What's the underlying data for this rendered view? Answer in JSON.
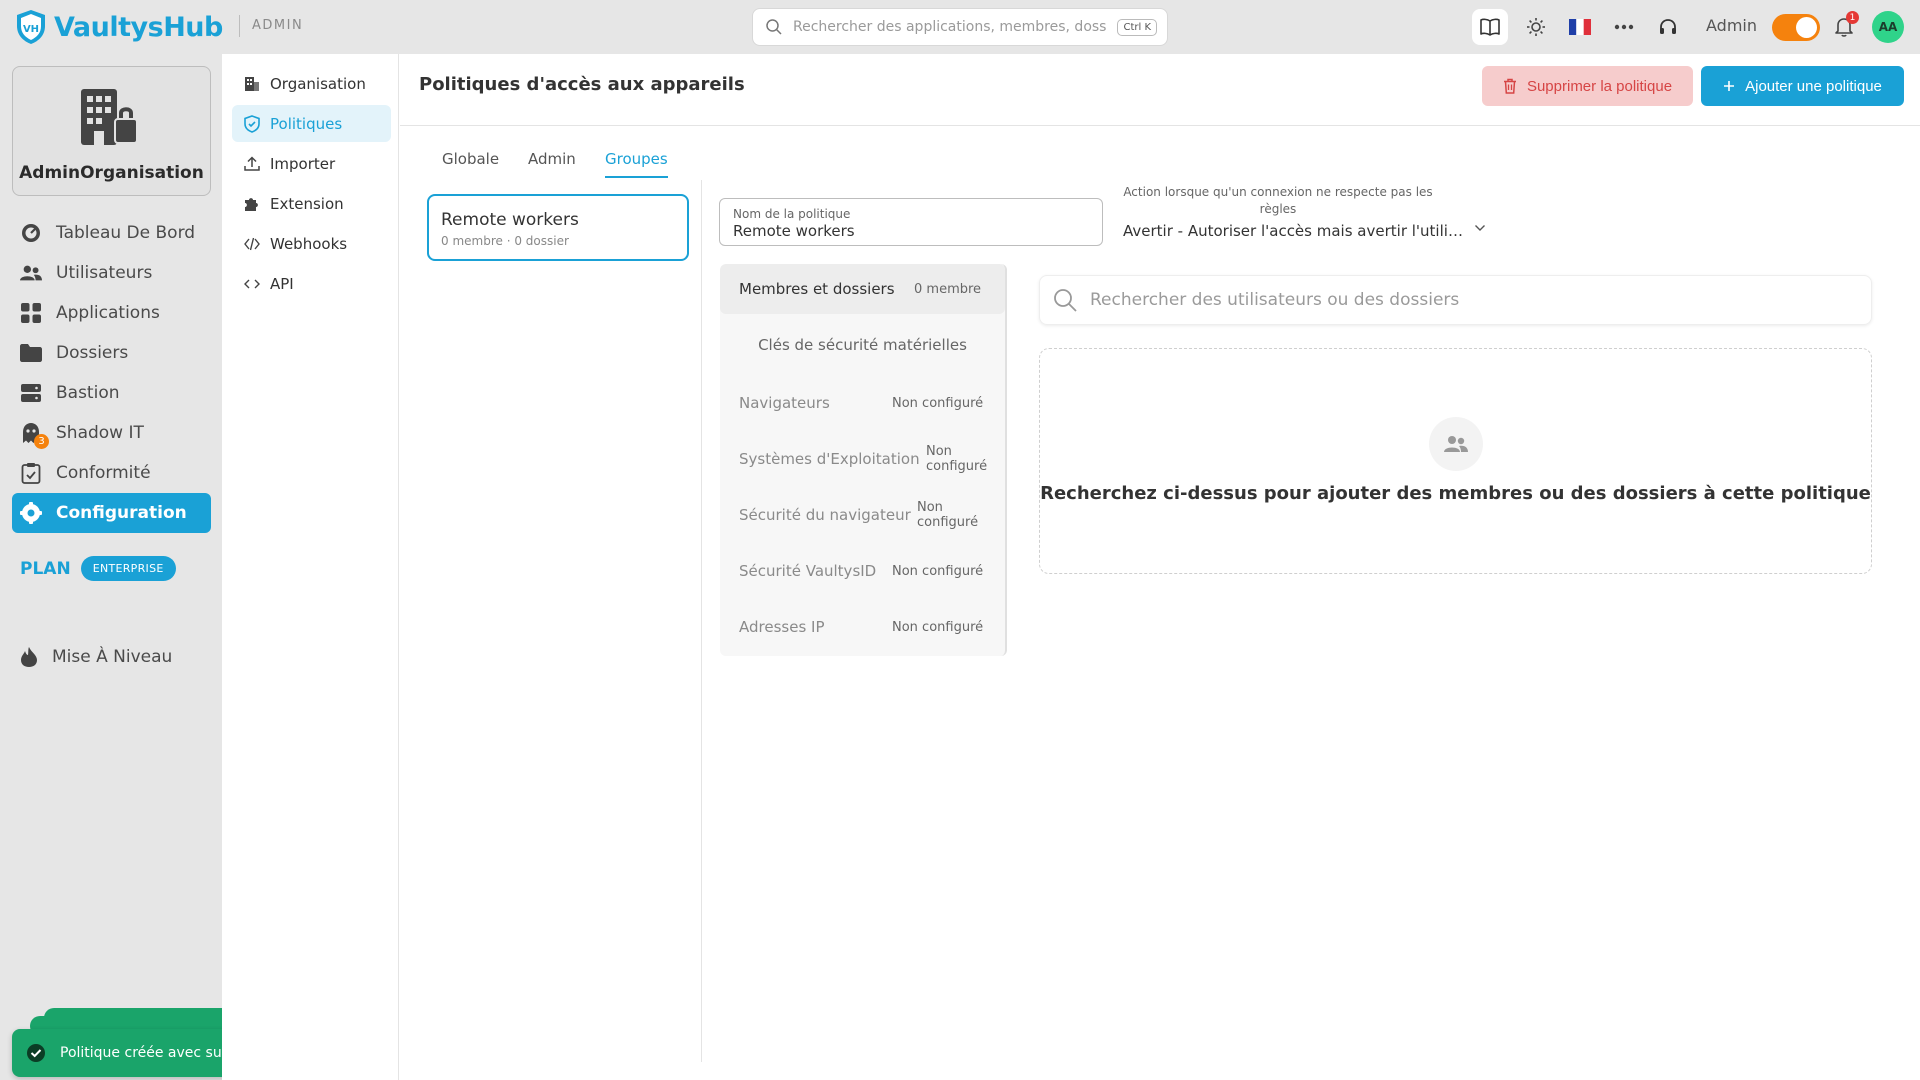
{
  "header": {
    "brand": "VaultysHub",
    "section": "ADMIN",
    "search_placeholder": "Rechercher des applications, membres, dossiers",
    "search_shortcut": "Ctrl K",
    "user_mode": "Admin",
    "notifications": "1",
    "avatar_initials": "AA"
  },
  "sidebar": {
    "org_name": "AdminOrganisation",
    "items": [
      {
        "label": "Tableau De Bord",
        "icon": "gauge-icon"
      },
      {
        "label": "Utilisateurs",
        "icon": "users-icon"
      },
      {
        "label": "Applications",
        "icon": "grid-icon"
      },
      {
        "label": "Dossiers",
        "icon": "folder-icon"
      },
      {
        "label": "Bastion",
        "icon": "server-icon"
      },
      {
        "label": "Shadow IT",
        "icon": "ghost-icon",
        "badge": "3"
      },
      {
        "label": "Conformité",
        "icon": "clipboard-check-icon"
      },
      {
        "label": "Configuration",
        "icon": "gear-icon",
        "active": true
      }
    ],
    "plan_label": "PLAN",
    "plan_badge": "ENTERPRISE",
    "upgrade": "Mise À Niveau"
  },
  "subnav": {
    "items": [
      {
        "label": "Organisation",
        "icon": "building-icon"
      },
      {
        "label": "Politiques",
        "icon": "shield-icon",
        "active": true
      },
      {
        "label": "Importer",
        "icon": "upload-icon"
      },
      {
        "label": "Extension",
        "icon": "puzzle-icon"
      },
      {
        "label": "Webhooks",
        "icon": "webhook-icon"
      },
      {
        "label": "API",
        "icon": "code-icon"
      }
    ]
  },
  "main": {
    "title": "Politiques d'accès aux appareils",
    "delete_button": "Supprimer la politique",
    "add_button": "Ajouter une politique",
    "tabs": [
      "Globale",
      "Admin",
      "Groupes"
    ],
    "active_tab": "Groupes",
    "group": {
      "name": "Remote workers",
      "meta": "0 membre · 0 dossier"
    },
    "policy_name_label": "Nom de la politique",
    "policy_name_value": "Remote workers",
    "action_label": "Action lorsque qu'un connexion ne respecte pas les règles",
    "action_value": "Avertir - Autoriser l'accès mais avertir l'utilisateur",
    "rules": [
      {
        "label": "Membres et dossiers",
        "status": "0 membre"
      },
      {
        "label": "Clés de sécurité matérielles",
        "status": ""
      },
      {
        "label": "Navigateurs",
        "status": "Non configuré"
      },
      {
        "label": "Systèmes d'Exploitation",
        "status": "Non configuré"
      },
      {
        "label": "Sécurité du navigateur",
        "status": "Non configuré"
      },
      {
        "label": "Sécurité VaultysID",
        "status": "Non configuré"
      },
      {
        "label": "Adresses IP",
        "status": "Non configuré"
      }
    ],
    "member_search_placeholder": "Rechercher des utilisateurs ou des dossiers",
    "empty_text": "Recherchez ci-dessus pour ajouter des membres ou des dossiers à cette politique"
  },
  "toast": {
    "message": "Politique créée avec succès"
  },
  "colors": {
    "accent": "#1aa1d6",
    "success": "#1aa46a",
    "toggle": "#f5820d",
    "danger_bg": "#f6cccc",
    "danger_text": "#d64545"
  }
}
